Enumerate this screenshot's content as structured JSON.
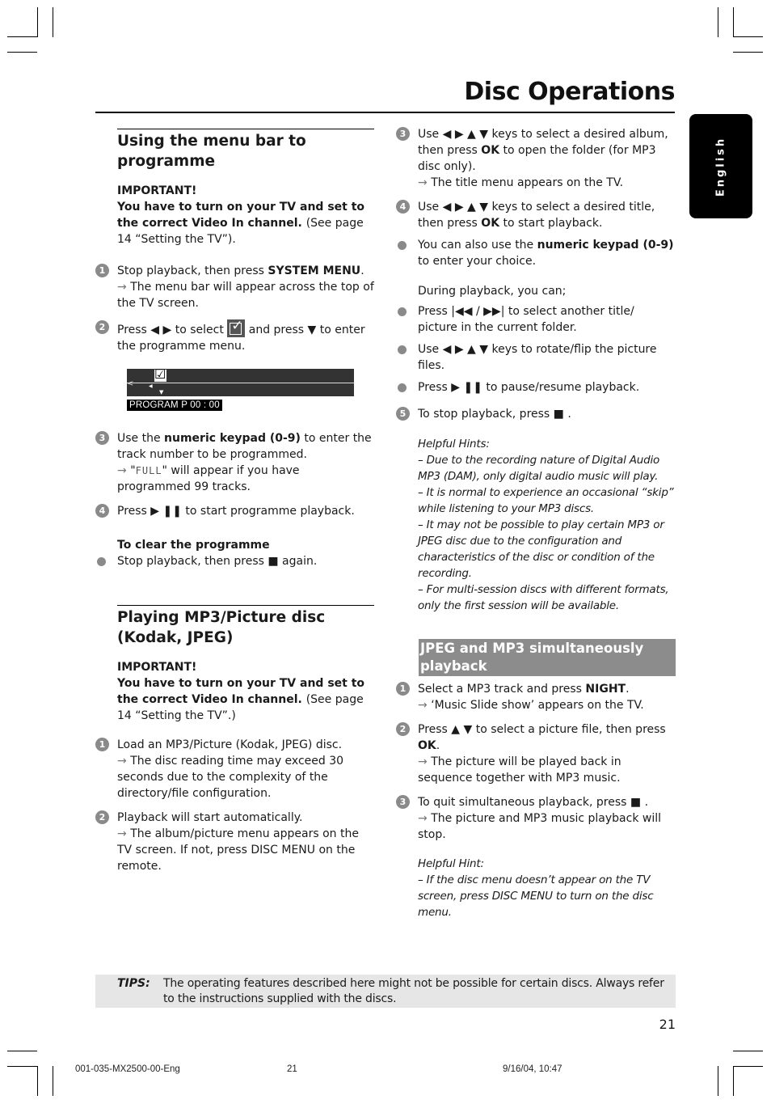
{
  "page": {
    "title": "Disc Operations",
    "language_tab": "English",
    "page_number": "21"
  },
  "left": {
    "section1": {
      "heading": "Using the menu bar to programme",
      "important_label": "IMPORTANT!",
      "important_bold": "You have to turn on your TV and set to the correct Video In channel.",
      "important_ref": "(See page 14 “Setting the TV”).",
      "steps": [
        {
          "num": "1",
          "pre": "Stop playback, then press ",
          "bold": "SYSTEM MENU",
          "post": ".",
          "result": "The menu bar will appear across the top of the TV screen."
        },
        {
          "num": "2",
          "pre": "Press ◀ ▶ to select",
          "mid": "and press ▼ to enter the programme menu."
        },
        {
          "num": "3",
          "pre": "Use the ",
          "bold": "numeric keypad (0-9)",
          "post": " to enter the track number to be programmed.",
          "result_pre": "\"",
          "result_lcd": "FULL",
          "result_post": "\" will appear if you have programmed 99 tracks."
        },
        {
          "num": "4",
          "text": "Press  ▶ ❚❚ to start programme playback."
        }
      ],
      "menu_display": {
        "label": "PROGRAM    P 00 : 00"
      },
      "clear_heading": "To clear the programme",
      "clear_bullet": "Stop playback, then press ■ again."
    },
    "section2": {
      "heading": "Playing MP3/Picture disc (Kodak, JPEG)",
      "important_label": "IMPORTANT!",
      "important_bold": "You have to turn on your TV and set to the correct Video In channel.",
      "important_ref": "(See page 14 “Setting the TV”.)",
      "steps": [
        {
          "num": "1",
          "text": "Load an MP3/Picture (Kodak, JPEG) disc.",
          "result": "The disc reading time may exceed 30 seconds due to the complexity of the directory/file configuration."
        },
        {
          "num": "2",
          "text": "Playback will start automatically.",
          "result": "The album/picture menu appears on the TV screen.  If not, press DISC MENU on the remote."
        }
      ]
    }
  },
  "right": {
    "steps_a": [
      {
        "num": "3",
        "pre": "Use ◀ ▶ ▲ ▼ keys to select a desired album, then press ",
        "bold": "OK",
        "post": " to open the folder (for MP3 disc only).",
        "result": "The title menu appears on the TV."
      },
      {
        "num": "4",
        "pre": "Use ◀ ▶ ▲ ▼ keys to select a desired title, then press ",
        "bold": "OK",
        "post": " to start playback."
      }
    ],
    "bullet_keypad": {
      "pre": "You can also use the ",
      "bold": "numeric keypad (0-9)",
      "post": " to enter your choice."
    },
    "during_label": "During playback, you can;",
    "during_bullets": [
      "Press |◀◀ / ▶▶| to select another title/ picture in the current folder.",
      "Use ◀ ▶ ▲ ▼ keys to rotate/flip the picture files.",
      "Press  ▶ ❚❚ to pause/resume playback."
    ],
    "step5": {
      "num": "5",
      "text": "To stop playback, press  ■ ."
    },
    "hints_label": "Helpful Hints:",
    "hints": [
      "–  Due to the recording nature of Digital Audio MP3 (DAM), only digital audio music will play.",
      "–  It is normal to experience an occasional “skip” while listening to your MP3 discs.",
      "–  It may not be possible to play certain MP3 or JPEG disc due to the configuration and characteristics of the disc or condition of the recording.",
      "–  For multi-session discs with different formats, only the first session will be available."
    ],
    "section3": {
      "heading": "JPEG and MP3 simultaneously playback",
      "steps": [
        {
          "num": "1",
          "pre": "Select a MP3 track and press ",
          "bold": "NIGHT",
          "post": ".",
          "result": "‘Music Slide show’ appears on the TV."
        },
        {
          "num": "2",
          "pre": "Press ▲ ▼ to select a picture file, then press ",
          "bold": "OK",
          "post": ".",
          "result": "The picture will be played back in sequence together with MP3 music."
        },
        {
          "num": "3",
          "pre": "To quit simultaneous playback, press  ■ .",
          "result": "The picture and MP3 music playback will stop."
        }
      ],
      "hint_label": "Helpful Hint:",
      "hint": "–  If the disc menu doesn’t appear on the TV screen, press DISC MENU to turn on the disc menu."
    }
  },
  "tips": {
    "label": "TIPS:",
    "text": "The operating features described here might not be possible for certain discs.  Always refer to the instructions supplied with the discs."
  },
  "footer": {
    "doc_id": "001-035-MX2500-00-Eng",
    "page": "21",
    "timestamp": "9/16/04, 10:47"
  },
  "icons": {
    "arrow": "→"
  }
}
